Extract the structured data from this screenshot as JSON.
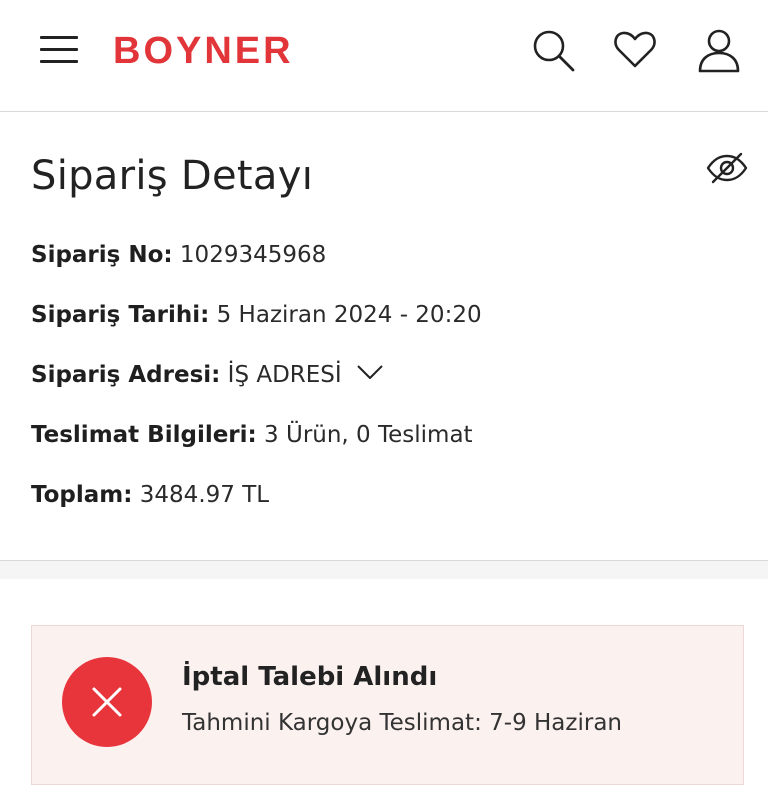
{
  "header": {
    "brand": "BOYNER",
    "brand_color": "#e2353a",
    "icons": [
      "menu-icon",
      "search-icon",
      "heart-icon",
      "user-icon"
    ]
  },
  "order": {
    "title": "Sipariş Detayı",
    "toggle_icon": "eye-off-icon",
    "fields": {
      "order_no": {
        "label": "Sipariş No:",
        "value": "1029345968"
      },
      "order_date": {
        "label": "Sipariş Tarihi:",
        "value": "5 Haziran 2024 - 20:20"
      },
      "address": {
        "label": "Sipariş Adresi:",
        "value": "İŞ ADRESİ"
      },
      "delivery_info": {
        "label": "Teslimat Bilgileri:",
        "value": "3 Ürün, 0 Teslimat"
      },
      "total": {
        "label": "Toplam:",
        "value": "3484.97 TL"
      }
    }
  },
  "status": {
    "title": "İptal Talebi Alındı",
    "subtitle": "Tahmini Kargoya Teslimat: 7-9 Haziran",
    "icon": "close-icon",
    "accent_color": "#e8353c",
    "card_color": "#fbf1ef"
  }
}
